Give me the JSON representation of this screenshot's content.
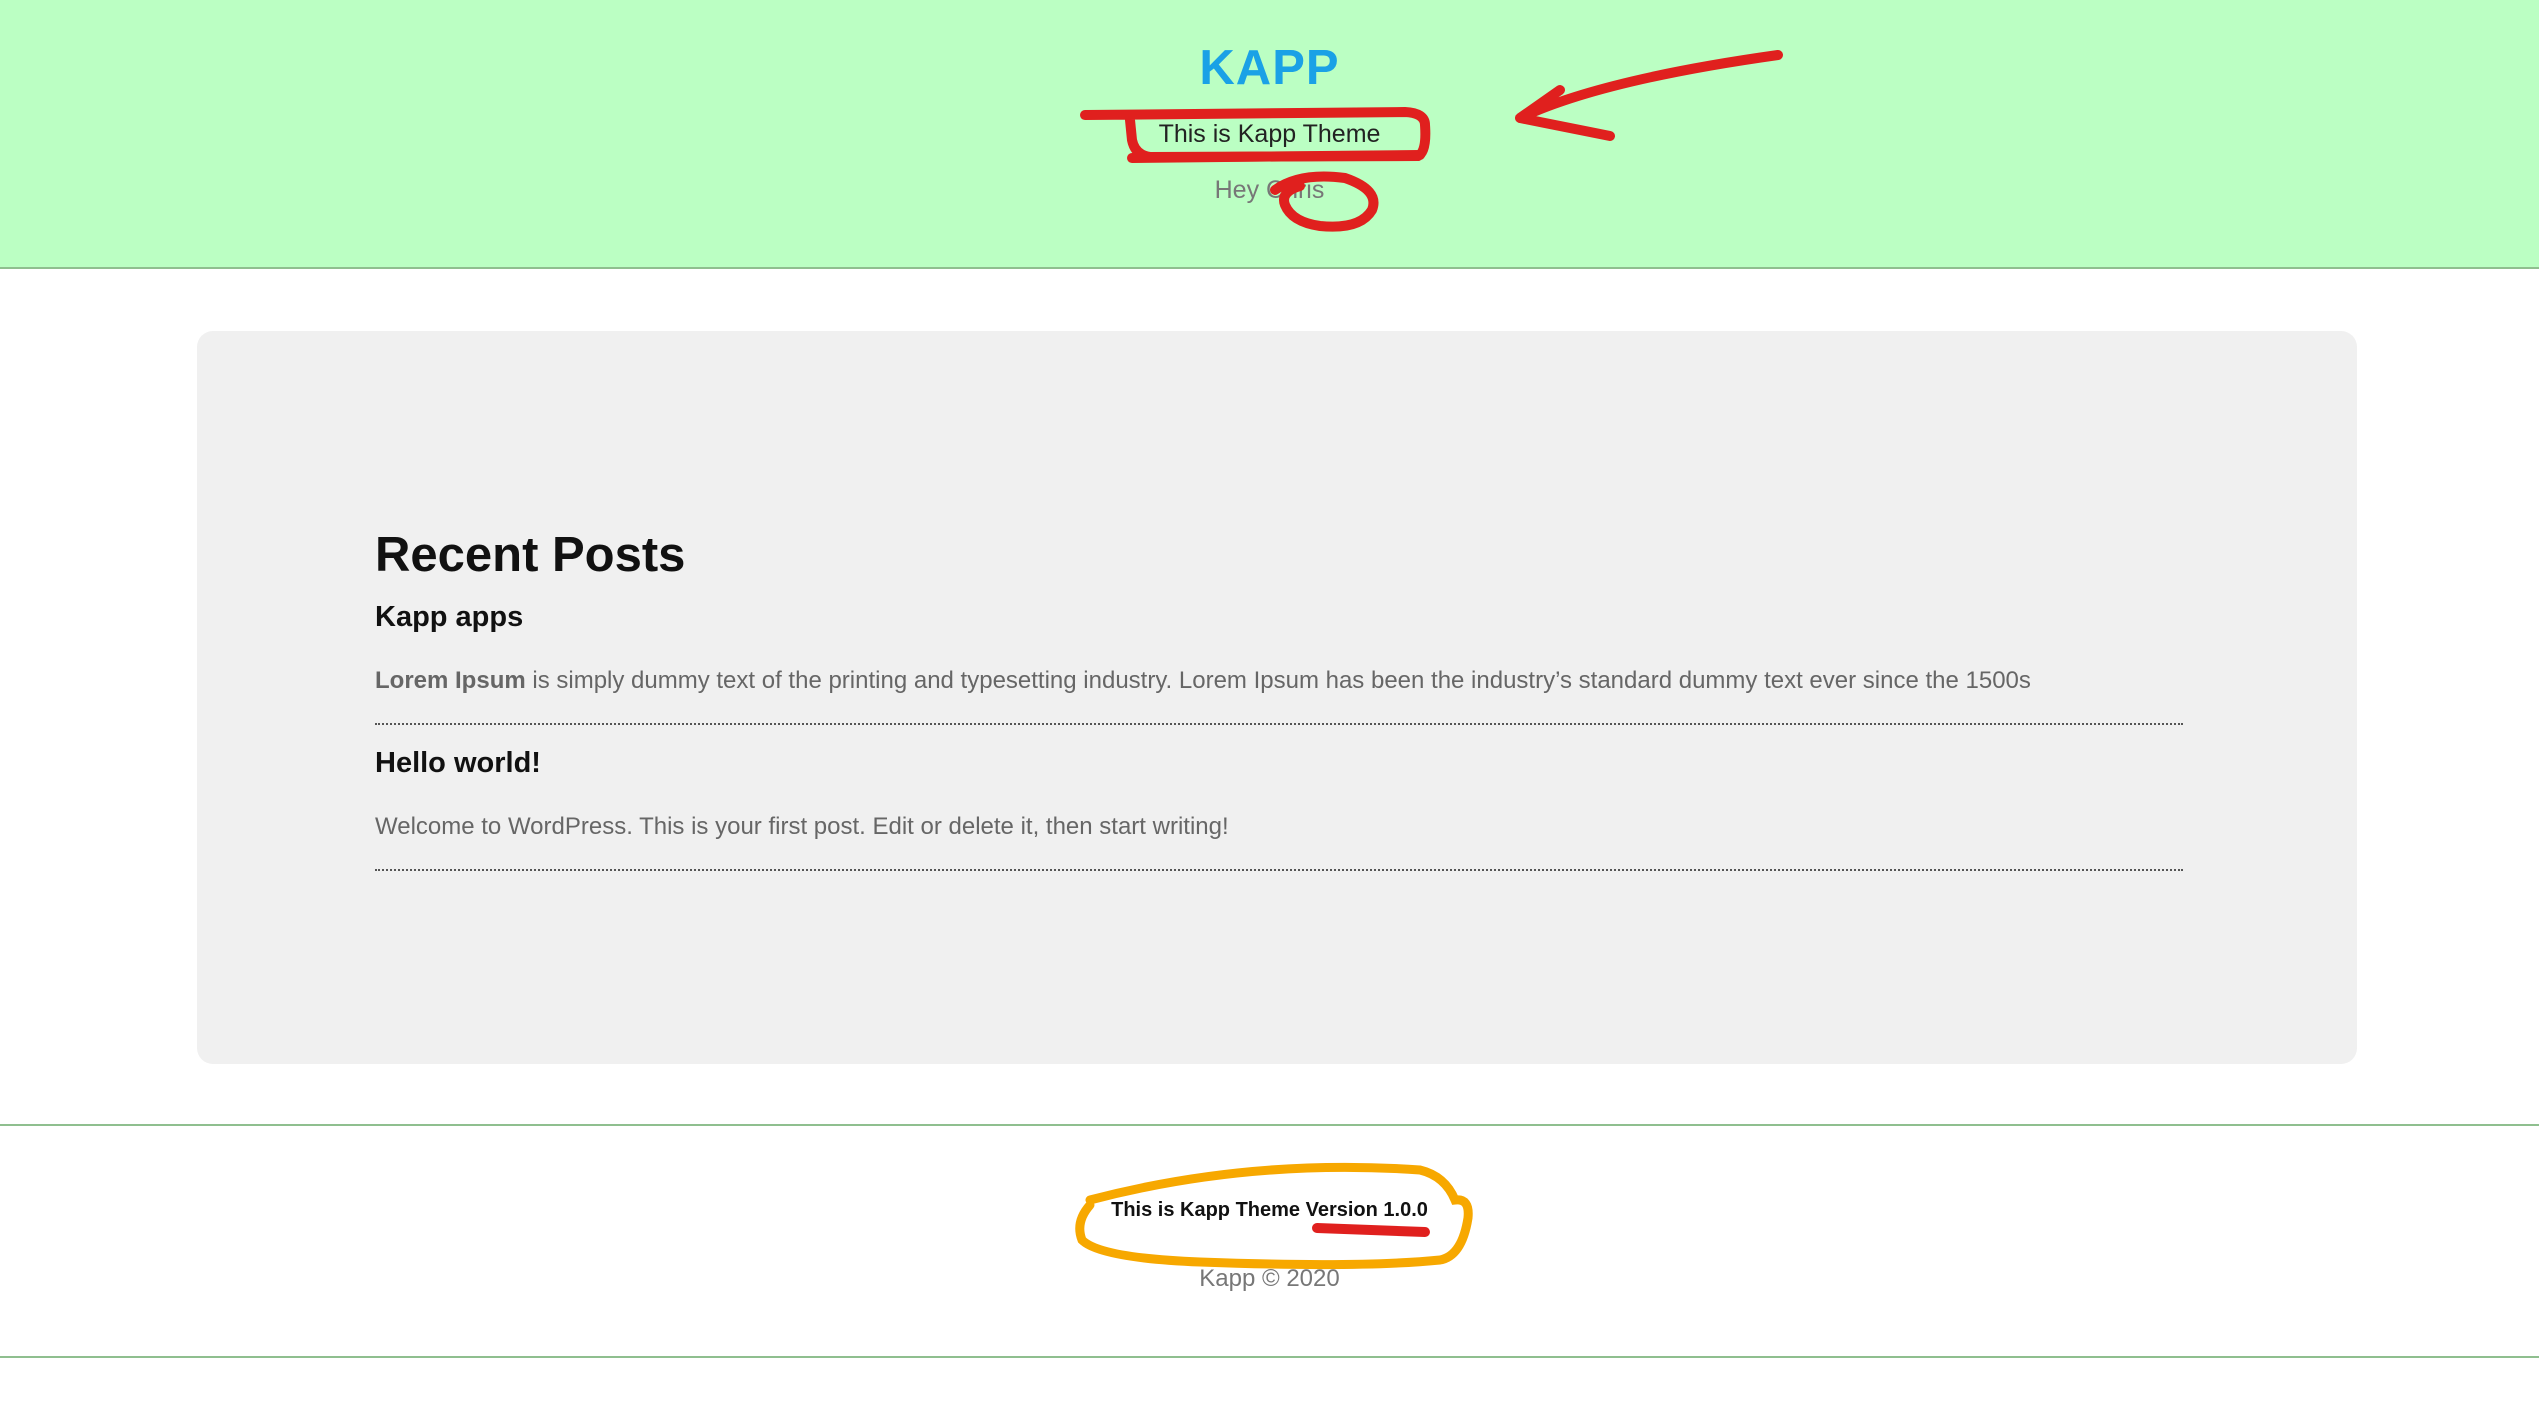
{
  "header": {
    "site_title": "KAPP",
    "tagline": "This is Kapp Theme",
    "greeting": "Hey Chris",
    "background": "#bbffc3",
    "title_color": "#1aa1e6"
  },
  "main": {
    "heading": "Recent Posts",
    "posts": [
      {
        "title": "Kapp apps",
        "excerpt_bold": "Lorem Ipsum",
        "excerpt_rest": " is simply dummy text of the printing and typesetting industry. Lorem Ipsum has been the industry’s standard dummy text ever since the 1500s"
      },
      {
        "title": "Hello world!",
        "excerpt_bold": "",
        "excerpt_rest": "Welcome to WordPress. This is your first post. Edit or delete it, then start writing!"
      }
    ],
    "card_background": "#f0f0f0"
  },
  "footer": {
    "theme_label": "This is Kapp Theme ",
    "version_label": "Version 1.0.0",
    "copyright": "Kapp © 2020"
  },
  "annotations": {
    "red_color": "#e0201e",
    "orange_color": "#f7a800"
  }
}
